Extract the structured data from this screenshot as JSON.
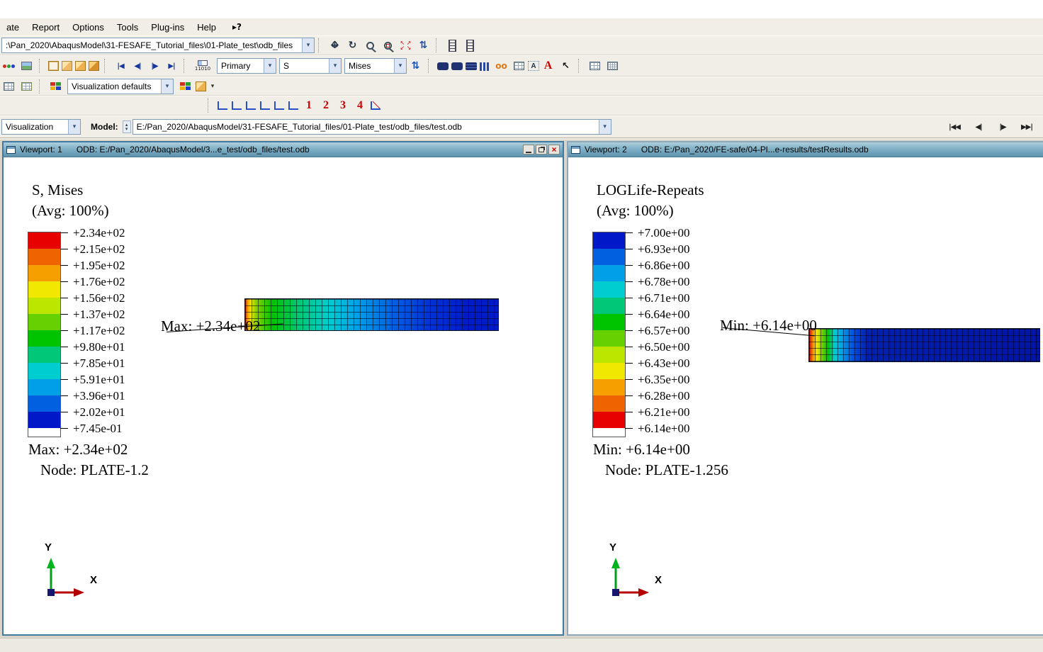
{
  "menu": {
    "items": [
      "ate",
      "Report",
      "Options",
      "Tools",
      "Plug-ins",
      "Help"
    ]
  },
  "icons": {
    "dropdown": "▾",
    "pan_h": "↔",
    "pan_v": "↕",
    "rotate": "↻",
    "updown": "⇅",
    "refresh": "⇅",
    "help_arrow": "▸",
    "question": "?",
    "spin_up": "▴",
    "spin_down": "▾",
    "close": "×",
    "cursor": "↖",
    "annotation_a": "A",
    "red_a": "A",
    "oo": "oo",
    "fit_arrows": [
      "↖",
      "↗",
      "↙",
      "↘"
    ]
  },
  "toolbar1": {
    "path_value": ":\\Pan_2020\\AbaqusModel\\31-FESAFE_Tutorial_files\\01-Plate_test\\odb_files",
    "icon_names": [
      "pan",
      "rotate",
      "magnify",
      "box-zoom",
      "auto-fit",
      "cycle-views",
      "view-cut",
      "free-body-cut"
    ]
  },
  "toolbar2": {
    "vcr": [
      "|◀",
      "◀|",
      "|▶",
      "▶|"
    ],
    "field_output_bits": "11010",
    "primary_combo": "Primary",
    "field_combo": "S",
    "invariant_combo": "Mises"
  },
  "toolbar3": {
    "defaults_combo": "Visualization defaults"
  },
  "views_toolbar": {
    "numbers": [
      "1",
      "2",
      "3",
      "4"
    ]
  },
  "context_bar": {
    "module": "Visualization",
    "model_label": "Model:",
    "model_path": "E:/Pan_2020/AbaqusModel/31-FESAFE_Tutorial_files/01-Plate_test/odb_files/test.odb",
    "nav": [
      "|◀◀",
      "◀|",
      "|▶",
      "▶▶|"
    ]
  },
  "viewport1": {
    "title": "Viewport: 1",
    "odb": "ODB: E:/Pan_2020/AbaqusModel/3...e_test/odb_files/test.odb",
    "legend_title": "S, Mises",
    "legend_subtitle": "(Avg: 100%)",
    "legend_colors": [
      "#e60000",
      "#f06400",
      "#f5a000",
      "#f0e800",
      "#bce600",
      "#66d000",
      "#00c300",
      "#00c878",
      "#00cdd0",
      "#00a0e8",
      "#0060e0",
      "#0018c8"
    ],
    "legend_labels": [
      "+2.34e+02",
      "+2.15e+02",
      "+1.95e+02",
      "+1.76e+02",
      "+1.56e+02",
      "+1.37e+02",
      "+1.17e+02",
      "+9.80e+01",
      "+7.85e+01",
      "+5.91e+01",
      "+3.96e+01",
      "+2.02e+01",
      "+7.45e-01"
    ],
    "max_line": "Max: +2.34e+02",
    "node_line": "Node: PLATE-1.2",
    "annotation": "Max: +2.34e+02",
    "axis_x": "X",
    "axis_y": "Y"
  },
  "viewport2": {
    "title": "Viewport: 2",
    "odb": "ODB: E:/Pan_2020/FE-safe/04-Pl...e-results/testResults.odb",
    "legend_title": "LOGLife-Repeats",
    "legend_subtitle": "(Avg: 100%)",
    "legend_colors": [
      "#0018c8",
      "#0060e0",
      "#00a0e8",
      "#00cdd0",
      "#00c878",
      "#00c300",
      "#66d000",
      "#bce600",
      "#f0e800",
      "#f5a000",
      "#f06400",
      "#e60000"
    ],
    "legend_labels": [
      "+7.00e+00",
      "+6.93e+00",
      "+6.86e+00",
      "+6.78e+00",
      "+6.71e+00",
      "+6.64e+00",
      "+6.57e+00",
      "+6.50e+00",
      "+6.43e+00",
      "+6.35e+00",
      "+6.28e+00",
      "+6.21e+00",
      "+6.14e+00"
    ],
    "min_line": "Min: +6.14e+00",
    "node_line": "Node: PLATE-1.256",
    "annotation": "Min: +6.14e+00",
    "axis_x": "X",
    "axis_y": "Y"
  }
}
